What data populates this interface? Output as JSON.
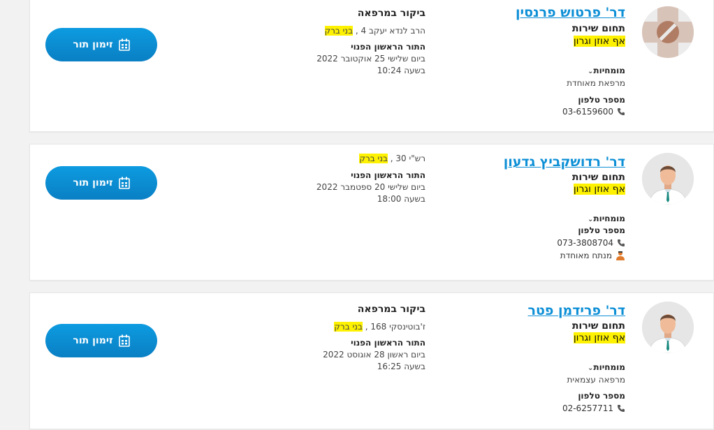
{
  "results": [
    {
      "name": "דר' פרטוש פרנסין",
      "service_label": "תחום שירות",
      "specialty": "אף אוזן וגרון",
      "expertise_label": "מומחיות",
      "expertise_value": "מרפאת מאוחדת",
      "phone_label": "מספר טלפון",
      "phone": "03-6159600",
      "visit_label": "ביקור במרפאה",
      "address_prefix": "הרב לנדא יעקב 4 ,",
      "city": "בני ברק",
      "first_available_label": "התור הראשון הפנוי",
      "date": "ביום שלישי 25 אוקטובר 2022",
      "time": "בשעה 10:24",
      "book_label": "זימון תור"
    },
    {
      "name": "דר' רדושקביץ גדעון",
      "service_label": "תחום שירות",
      "specialty": "אף אוזן וגרון",
      "expertise_label": "מומחיות",
      "phone_label": "מספר טלפון",
      "phone": "073-3808704",
      "extra_label": "מנתח מאוחדת",
      "address_prefix": "רש\"י 30 ,",
      "city": "בני ברק",
      "first_available_label": "התור הראשון הפנוי",
      "date": "ביום שלישי 20 ספטמבר 2022",
      "time": "בשעה 18:00",
      "book_label": "זימון תור"
    },
    {
      "name": "דר' פרידמן פטר",
      "service_label": "תחום שירות",
      "specialty": "אף אוזן וגרון",
      "expertise_label": "מומחיות",
      "expertise_value": "מרפאה עצמאית",
      "phone_label": "מספר טלפון",
      "phone": "02-6257711",
      "visit_label": "ביקור במרפאה",
      "address_prefix": "ז'בוטינסקי 168 ,",
      "city": "בני ברק",
      "first_available_label": "התור הראשון הפנוי",
      "date": "ביום ראשון 28 אוגוסט 2022",
      "time": "בשעה 16:25",
      "book_label": "זימון תור"
    }
  ],
  "icons": {
    "phone": "phone-icon",
    "calendar": "calendar-icon",
    "surgeon": "surgeon-icon",
    "chevron": "chevron-down-icon"
  },
  "colors": {
    "accent": "#0d8fd6",
    "highlight": "#fff200",
    "button": "#0a8ed3"
  }
}
